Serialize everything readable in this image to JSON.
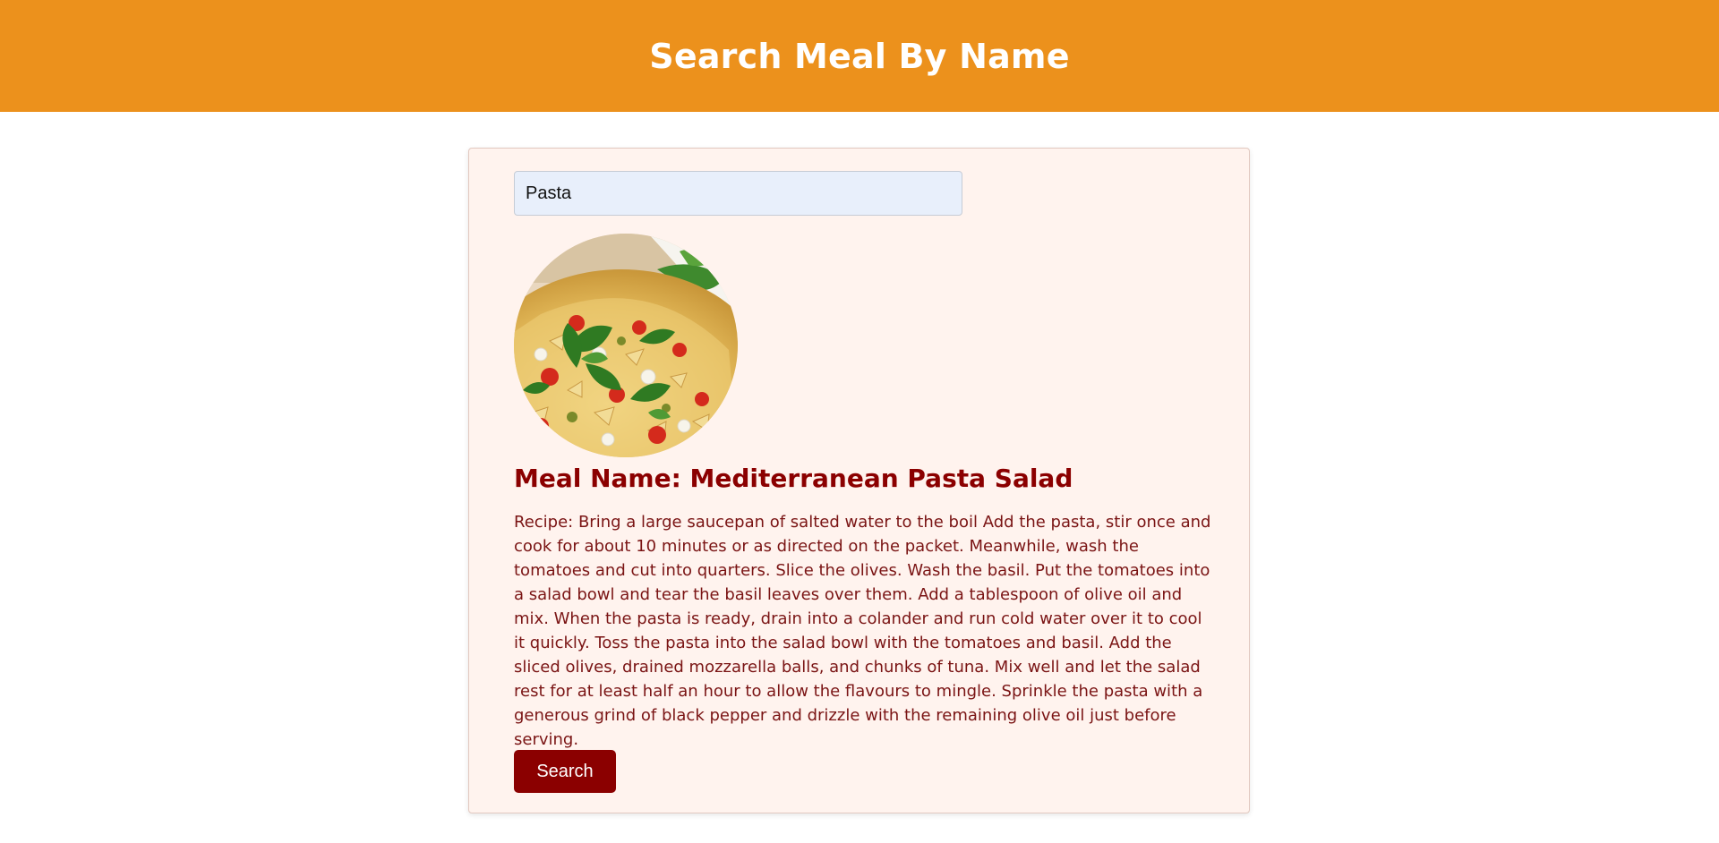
{
  "header": {
    "title": "Search Meal By Name"
  },
  "search": {
    "value": "Pasta",
    "button_label": "Search"
  },
  "meal": {
    "name": "Meal Name: Mediterranean Pasta Salad",
    "recipe": "Recipe: Bring a large saucepan of salted water to the boil Add the pasta, stir once and cook for about 10 minutes or as directed on the packet. Meanwhile, wash the tomatoes and cut into quarters. Slice the olives. Wash the basil. Put the tomatoes into a salad bowl and tear the basil leaves over them. Add a tablespoon of olive oil and mix. When the pasta is ready, drain into a colander and run cold water over it to cool it quickly. Toss the pasta into the salad bowl with the tomatoes and basil. Add the sliced olives, drained mozzarella balls, and chunks of tuna. Mix well and let the salad rest for at least half an hour to allow the flavours to mingle. Sprinkle the pasta with a generous grind of black pepper and drizzle with the remaining olive oil just before serving."
  },
  "colors": {
    "header_bg": "#ec911c",
    "card_bg": "#fff3ee",
    "accent": "#8b0000",
    "input_bg": "#e8effb"
  }
}
